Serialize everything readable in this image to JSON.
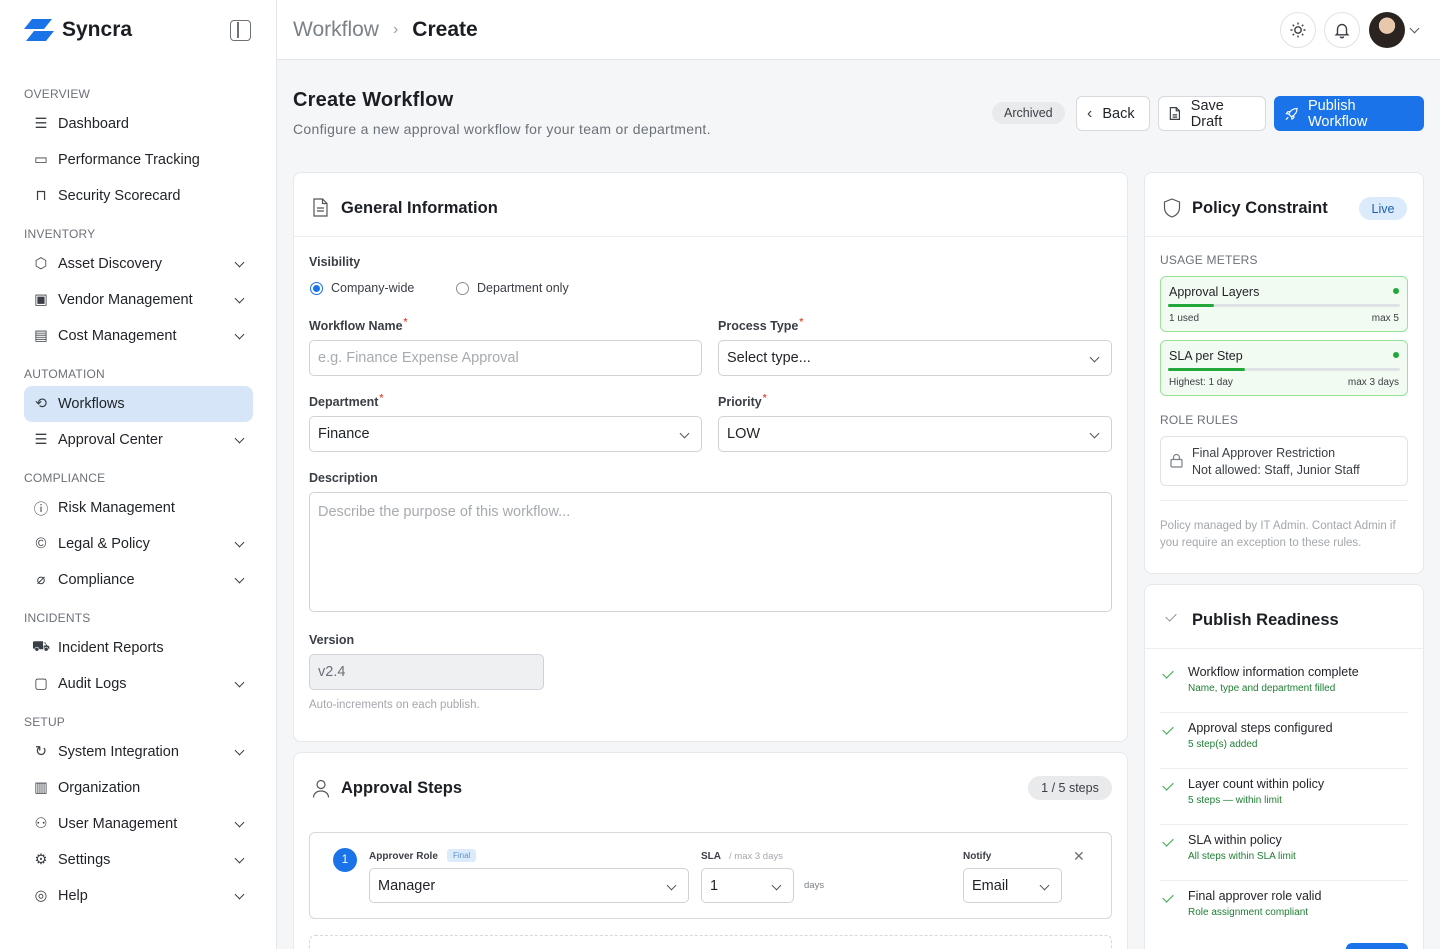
{
  "app": {
    "name": "Syncra"
  },
  "sidebar": {
    "sections": [
      {
        "label": "OVERVIEW"
      },
      {
        "label": "INVENTORY"
      },
      {
        "label": "AUTOMATION"
      },
      {
        "label": "COMPLIANCE"
      },
      {
        "label": "INCIDENTS"
      },
      {
        "label": "SETUP"
      }
    ],
    "items": [
      {
        "label": "Dashboard",
        "icon": "list-icon",
        "expandable": false
      },
      {
        "label": "Performance Tracking",
        "icon": "monitor-icon",
        "expandable": false
      },
      {
        "label": "Security Scorecard",
        "icon": "lock-icon",
        "expandable": false
      },
      {
        "label": "Asset Discovery",
        "icon": "box-icon",
        "expandable": true
      },
      {
        "label": "Vendor Management",
        "icon": "vendor-icon",
        "expandable": true
      },
      {
        "label": "Cost Management",
        "icon": "card-icon",
        "expandable": true
      },
      {
        "label": "Workflows",
        "icon": "workflow-icon",
        "expandable": false,
        "active": true
      },
      {
        "label": "Approval Center",
        "icon": "list-icon",
        "expandable": true
      },
      {
        "label": "Risk Management",
        "icon": "alert-icon",
        "expandable": false
      },
      {
        "label": "Legal & Policy",
        "icon": "copyright-icon",
        "expandable": true
      },
      {
        "label": "Compliance",
        "icon": "tag-icon",
        "expandable": true
      },
      {
        "label": "Incident Reports",
        "icon": "truck-icon",
        "expandable": false
      },
      {
        "label": "Audit Logs",
        "icon": "calendar-icon",
        "expandable": true
      },
      {
        "label": "System Integration",
        "icon": "refresh-icon",
        "expandable": true
      },
      {
        "label": "Organization",
        "icon": "building-icon",
        "expandable": false
      },
      {
        "label": "User Management",
        "icon": "users-icon",
        "expandable": true
      },
      {
        "label": "Settings",
        "icon": "gear-icon",
        "expandable": true
      },
      {
        "label": "Help",
        "icon": "help-icon",
        "expandable": true
      }
    ]
  },
  "header": {
    "breadcrumb": [
      "Workflow",
      "Create"
    ]
  },
  "page": {
    "title": "Create Workflow",
    "subtitle": "Configure a new approval workflow for your team or department.",
    "status_badge": "Archived",
    "back_label": "Back",
    "save_draft_label": "Save Draft",
    "publish_label": "Publish Workflow"
  },
  "general": {
    "title": "General Information",
    "visibility_label": "Visibility",
    "visibility_options": [
      "Company-wide",
      "Department only"
    ],
    "visibility_selected": "Company-wide",
    "workflow_name_label": "Workflow Name",
    "workflow_name_placeholder": "e.g. Finance Expense Approval",
    "process_type_label": "Process Type",
    "process_type_value": "Select type...",
    "department_label": "Department",
    "department_value": "Finance",
    "priority_label": "Priority",
    "priority_value": "LOW",
    "description_label": "Description",
    "description_placeholder": "Describe the purpose of this workflow...",
    "version_label": "Version",
    "version_value": "v2.4",
    "version_hint": "Auto-increments on each publish."
  },
  "steps": {
    "title": "Approval Steps",
    "count_badge": "1 / 5 steps",
    "step1": {
      "number": "1",
      "role_label": "Approver Role",
      "final_tag": "Final",
      "role_value": "Manager",
      "sla_label": "SLA",
      "sla_hint": "/ max 3 days",
      "sla_value": "1",
      "sla_unit": "days",
      "notify_label": "Notify",
      "notify_value": "Email"
    }
  },
  "policy": {
    "title": "Policy Constraint",
    "live_badge": "Live",
    "usage_label": "USAGE METERS",
    "meters": [
      {
        "title": "Approval Layers",
        "left": "1 used",
        "right": "max 5",
        "fill": 0.2,
        "color": "#22a83a"
      },
      {
        "title": "SLA per Step",
        "left": "Highest: 1 day",
        "right": "max 3 days",
        "fill": 0.33,
        "color": "#22a83a"
      }
    ],
    "role_rules_label": "ROLE RULES",
    "rule_title": "Final Approver Restriction",
    "rule_detail": "Not allowed: Staff, Junior Staff",
    "note": "Policy managed by IT Admin. Contact Admin if you require an exception to these rules."
  },
  "readiness": {
    "title": "Publish Readiness",
    "items": [
      {
        "title": "Workflow information complete",
        "sub": "Name, type and department filled"
      },
      {
        "title": "Approval steps configured",
        "sub": "5 step(s) added"
      },
      {
        "title": "Layer count within policy",
        "sub": "5 steps — within limit"
      },
      {
        "title": "SLA within policy",
        "sub": "All steps within SLA limit"
      },
      {
        "title": "Final approver role valid",
        "sub": "Role assignment compliant"
      }
    ]
  },
  "colors": {
    "accent": "#1a73e8",
    "success": "#22a83a",
    "active_nav": "#d6e5f8"
  }
}
